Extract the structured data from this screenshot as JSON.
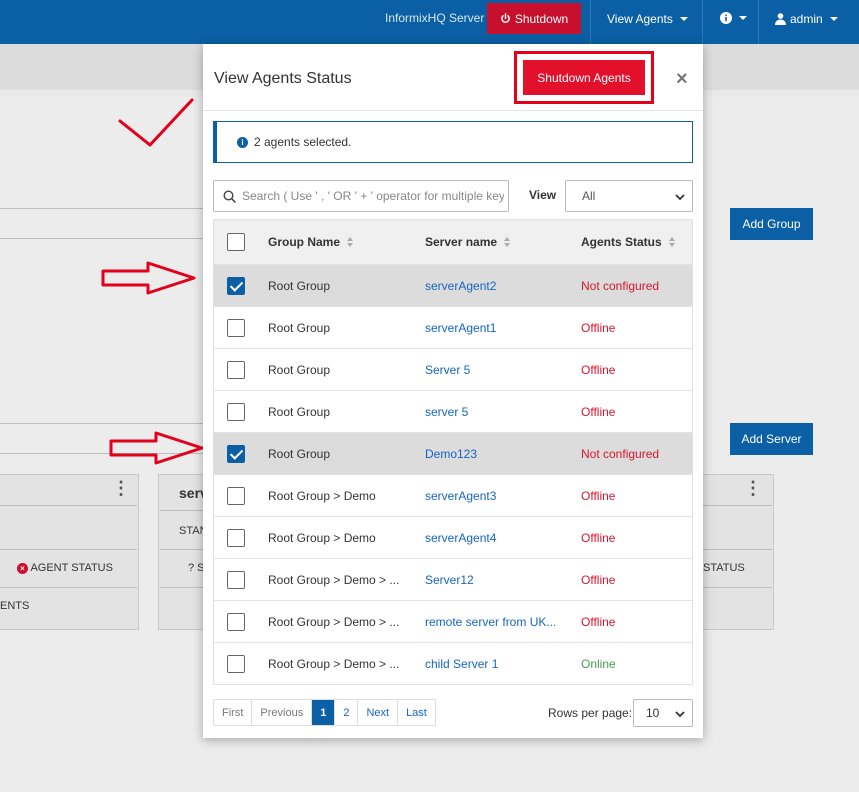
{
  "navbar": {
    "server_label": "InformixHQ Server",
    "shutdown_label": "Shutdown",
    "view_agents_label": "View Agents",
    "user_label": "admin",
    "bg_color": "#0b5fa5",
    "danger_color": "#c8102e"
  },
  "background": {
    "add_group_label": "Add Group",
    "add_server_label": "Add Server",
    "card1_status_label": "AGENT STATUS",
    "card1_footer_label": "ENTS",
    "card2_title": "serv",
    "card2_stan_label": "STAN",
    "card2_q_label": "? S",
    "card3_status_label": "STATUS"
  },
  "modal": {
    "title": "View Agents Status",
    "shutdown_agents_label": "Shutdown Agents",
    "close_label": "×",
    "info_text": "2 agents selected.",
    "search_placeholder": "Search ( Use ' , ' OR ' + ' operator for multiple keywords )",
    "view_label": "View",
    "view_value": "All",
    "columns": {
      "group_name": "Group Name",
      "server_name": "Server name",
      "agents_status": "Agents Status"
    },
    "rows": [
      {
        "group": "Root Group",
        "server": "serverAgent2",
        "status": "Not configured",
        "checked": true
      },
      {
        "group": "Root Group",
        "server": "serverAgent1",
        "status": "Offline",
        "checked": false
      },
      {
        "group": "Root Group",
        "server": "Server 5",
        "status": "Offline",
        "checked": false
      },
      {
        "group": "Root Group",
        "server": "server 5",
        "status": "Offline",
        "checked": false
      },
      {
        "group": "Root Group",
        "server": "Demo123",
        "status": "Not configured",
        "checked": true
      },
      {
        "group": "Root Group > Demo",
        "server": "serverAgent3",
        "status": "Offline",
        "checked": false
      },
      {
        "group": "Root Group > Demo",
        "server": "serverAgent4",
        "status": "Offline",
        "checked": false
      },
      {
        "group": "Root Group > Demo > ...",
        "server": "Server12",
        "status": "Offline",
        "checked": false
      },
      {
        "group": "Root Group > Demo > ...",
        "server": "remote server from UK...",
        "status": "Offline",
        "checked": false
      },
      {
        "group": "Root Group > Demo > ...",
        "server": "child Server 1",
        "status": "Online",
        "checked": false
      }
    ],
    "pagination": {
      "first": "First",
      "previous": "Previous",
      "page1": "1",
      "page2": "2",
      "next": "Next",
      "last": "Last",
      "rows_per_page_label": "Rows per page:",
      "rows_per_page_value": "10"
    }
  }
}
